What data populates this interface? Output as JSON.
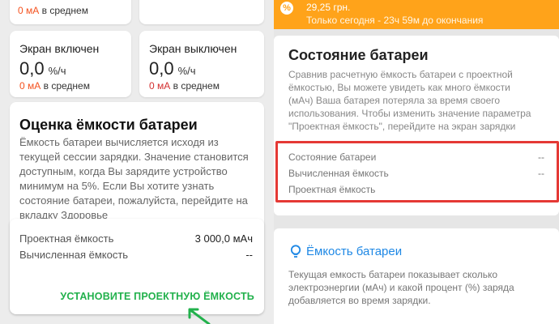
{
  "left": {
    "top_card": {
      "value": "0 мА",
      "suffix": "в среднем"
    },
    "screen_on": {
      "label": "Экран включен",
      "value": "0,0",
      "unit": "%/ч",
      "sub_value": "0 мА",
      "sub_suffix": "в среднем"
    },
    "screen_off": {
      "label": "Экран выключен",
      "value": "0,0",
      "unit": "%/ч",
      "sub_value": "0 мА",
      "sub_suffix": "в среднем"
    },
    "estimate": {
      "title": "Оценка ёмкости батареи",
      "lines": [
        "Ёмкость батареи вычисляется исходя из",
        "текущей сессии зарядки. Значение становится",
        "доступным, когда Вы зарядите устройство",
        "минимум на 5%. Если Вы хотите узнать",
        "состояние батареи, пожалуйста, перейдите на",
        "вкладку Здоровье"
      ]
    },
    "capacity_card": {
      "design_label": "Проектная ёмкость",
      "design_value": "3 000,0 мАч",
      "calc_label": "Вычисленная ёмкость",
      "calc_value": "--",
      "action_label": "УСТАНОВИТЕ ПРОЕКТНУЮ ЁМКОСТЬ"
    }
  },
  "right": {
    "promo": {
      "price": "29,25 грн.",
      "countdown": "Только сегодня - 23ч 59м до окончания"
    },
    "health": {
      "title": "Состояние батареи",
      "lines": [
        "Сравнив расчетную ёмкость батареи с проектной",
        "ёмкостью, Вы можете увидеть как много ёмкости",
        "(мАч) Ваша батарея потеряла за время своего",
        "использования. Чтобы изменить значение параметра",
        "\"Проектная ёмкость\", перейдите на экран зарядки"
      ],
      "rows": [
        {
          "label": "Состояние батареи",
          "value": "--"
        },
        {
          "label": "Вычисленная ёмкость",
          "value": "--"
        },
        {
          "label": "Проектная ёмкость",
          "value": ""
        }
      ]
    },
    "capacity": {
      "title": "Ёмкость батареи",
      "lines": [
        "Текущая емкость батареи показывает сколько",
        "электроэнергии (мАч) и какой процент (%) заряда",
        "добавляется во время зарядки."
      ]
    }
  },
  "colors": {
    "orange_banner": "#ffa31a",
    "accent_green": "#22b14c",
    "highlight_red": "#e53935",
    "link_blue": "#1e88e5"
  }
}
